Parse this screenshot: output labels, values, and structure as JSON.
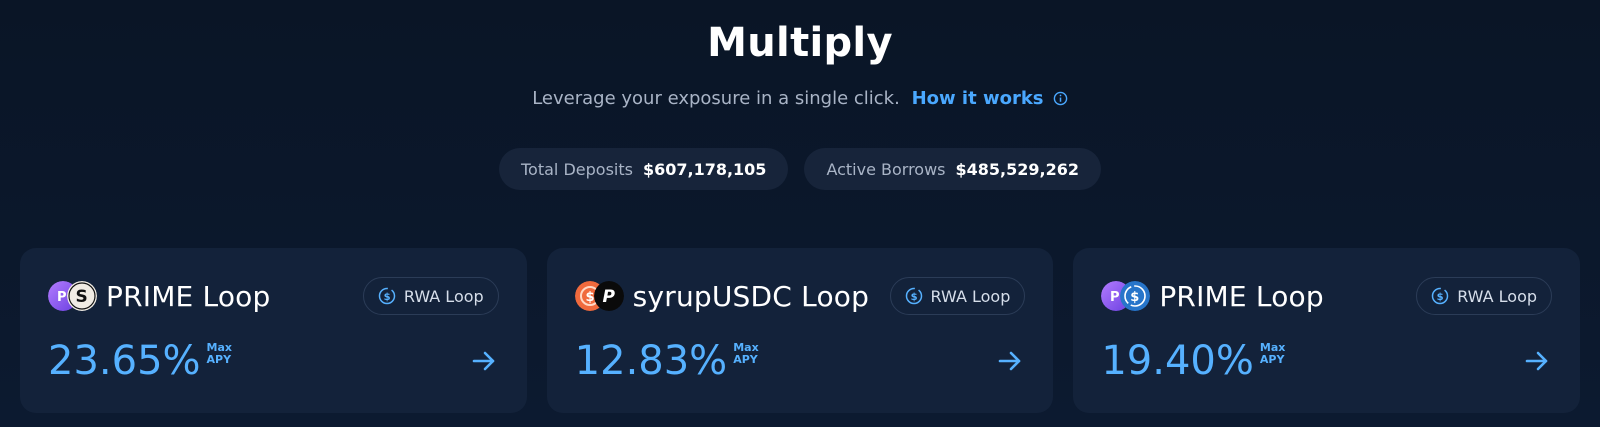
{
  "header": {
    "title": "Multiply",
    "subtitle": "Leverage your exposure in a single click.",
    "link_label": "How it works"
  },
  "stats": [
    {
      "label": "Total Deposits",
      "value": "$607,178,105"
    },
    {
      "label": "Active Borrows",
      "value": "$485,529,262"
    }
  ],
  "cards": [
    {
      "name": "PRIME Loop",
      "badge": "RWA Loop",
      "apy": "23.65%",
      "apy_label_1": "Max",
      "apy_label_2": "APY",
      "icons": [
        "prime-token-icon",
        "usds-token-icon"
      ]
    },
    {
      "name": "syrupUSDC Loop",
      "badge": "RWA Loop",
      "apy": "12.83%",
      "apy_label_1": "Max",
      "apy_label_2": "APY",
      "icons": [
        "syrup-token-icon",
        "pyusd-token-icon"
      ]
    },
    {
      "name": "PRIME Loop",
      "badge": "RWA Loop",
      "apy": "19.40%",
      "apy_label_1": "Max",
      "apy_label_2": "APY",
      "icons": [
        "prime-token-icon",
        "usdc-token-icon"
      ]
    }
  ],
  "colors": {
    "accent": "#4aa8ff",
    "apy": "#56b1ff",
    "card_bg": "#13223a",
    "page_bg": "#0b1628"
  }
}
